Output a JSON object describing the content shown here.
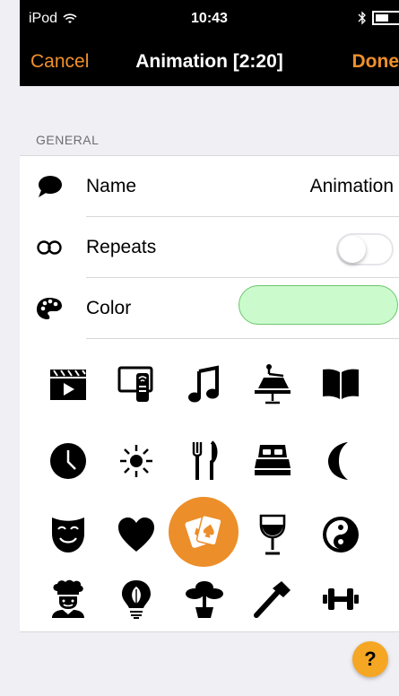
{
  "status_bar": {
    "carrier": "iPod",
    "time": "10:43"
  },
  "nav": {
    "cancel": "Cancel",
    "title": "Animation [2:20]",
    "done": "Done"
  },
  "section": {
    "header": "GENERAL"
  },
  "rows": {
    "name": {
      "label": "Name",
      "value": "Animation",
      "icon": "speech-bubble-icon"
    },
    "repeats": {
      "label": "Repeats",
      "on": false,
      "icon": "infinity-icon"
    },
    "color": {
      "label": "Color",
      "swatch": "#cbfbcc",
      "icon": "palette-icon"
    }
  },
  "icons": [
    [
      "clapperboard-icon",
      "tv-remote-icon",
      "music-note-icon",
      "desk-lamp-icon",
      "open-book-icon"
    ],
    [
      "clock-icon",
      "sun-icon",
      "fork-knife-icon",
      "bed-icon",
      "crescent-moon-icon"
    ],
    [
      "theater-mask-icon",
      "heart-icon",
      "playing-cards-icon",
      "wine-glass-icon",
      "yin-yang-icon"
    ],
    [
      "chef-icon",
      "lightbulb-leaf-icon",
      "bonsai-tree-icon",
      "hammer-icon",
      "dumbbell-icon"
    ]
  ],
  "selected_icon": "playing-cards-icon",
  "help": {
    "label": "?"
  },
  "colors": {
    "accent": "#f0902a",
    "selected_bg": "#ec8e2a",
    "help_bg": "#f5a623"
  }
}
